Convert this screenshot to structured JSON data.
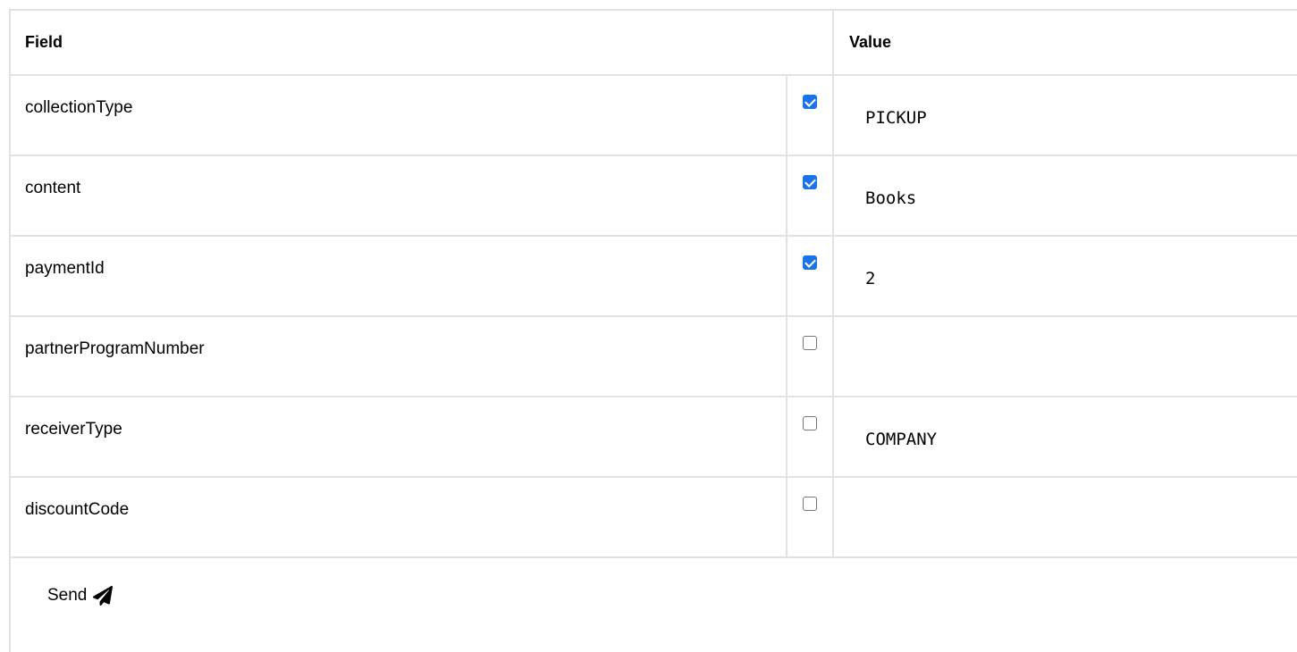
{
  "table": {
    "header": {
      "field": "Field",
      "value": "Value"
    },
    "rows": [
      {
        "field": "collectionType",
        "checked": true,
        "value": "PICKUP"
      },
      {
        "field": "content",
        "checked": true,
        "value": "Books"
      },
      {
        "field": "paymentId",
        "checked": true,
        "value": "2"
      },
      {
        "field": "partnerProgramNumber",
        "checked": false,
        "value": ""
      },
      {
        "field": "receiverType",
        "checked": false,
        "value": "COMPANY"
      },
      {
        "field": "discountCode",
        "checked": false,
        "value": ""
      }
    ]
  },
  "actions": {
    "send_label": "Send",
    "send_icon": "paper-plane-icon"
  },
  "colors": {
    "border": "#e2e2e2",
    "checkbox_checked": "#1a73e8"
  }
}
